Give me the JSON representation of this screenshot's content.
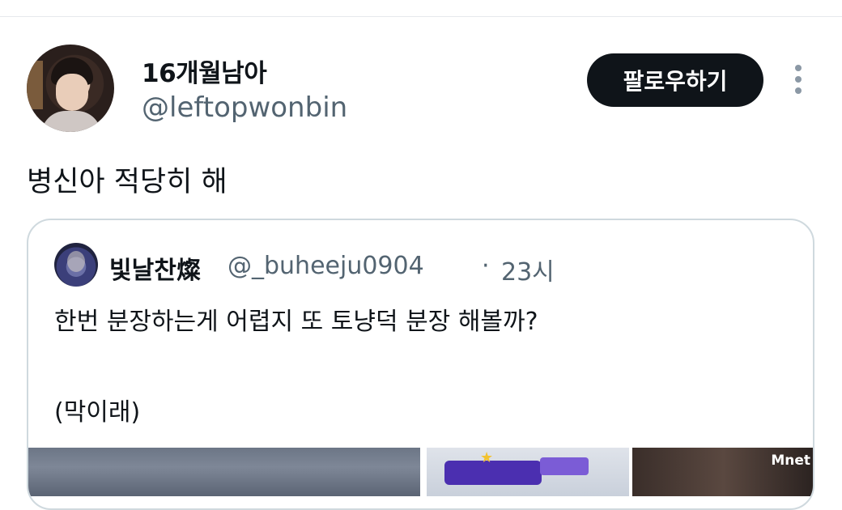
{
  "tweet": {
    "display_name": "16개월남아",
    "handle": "@leftopwonbin",
    "follow_label": "팔로우하기",
    "text": "병신아 적당히 해"
  },
  "quote": {
    "display_name": "빛날찬燦",
    "handle": "@_buheeju0904",
    "separator": "·",
    "time": "23시",
    "line1": "한번 분장하는게 어렵지 또 토냥덕 분장 해볼까?",
    "line2": "(막이래)"
  },
  "media": {
    "brand": "Mnet"
  },
  "colors": {
    "text": "#0f1419",
    "secondary": "#536471",
    "border": "#cfd9de",
    "button_bg": "#0f1419"
  },
  "icons": [
    "more-vertical-icon"
  ]
}
